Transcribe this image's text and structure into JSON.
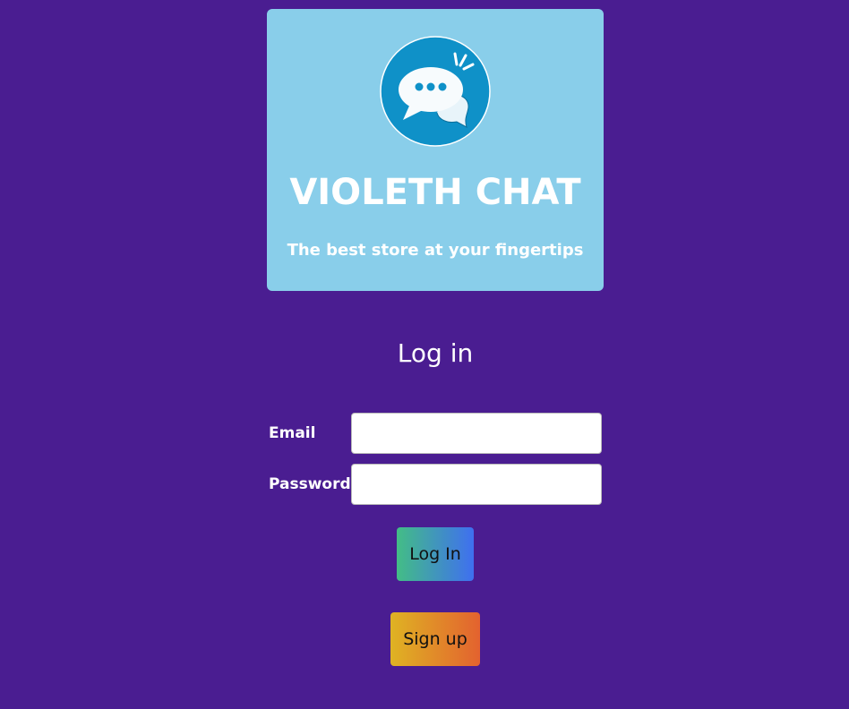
{
  "hero": {
    "logo_icon": "chat-bubbles-icon",
    "title": "VIOLETH CHAT",
    "tagline": "The best store at your fingertips"
  },
  "login": {
    "heading": "Log in",
    "email_label": "Email",
    "email_value": "",
    "password_label": "Password",
    "password_value": "",
    "login_button": "Log In",
    "signup_button": "Sign up"
  },
  "colors": {
    "background": "#4a1d91",
    "hero_background": "#89ceea",
    "logo_circle": "#0f91c8",
    "login_gradient": [
      "#43bd86",
      "#3f6ff0"
    ],
    "signup_gradient": [
      "#dfb323",
      "#e3622f"
    ]
  }
}
